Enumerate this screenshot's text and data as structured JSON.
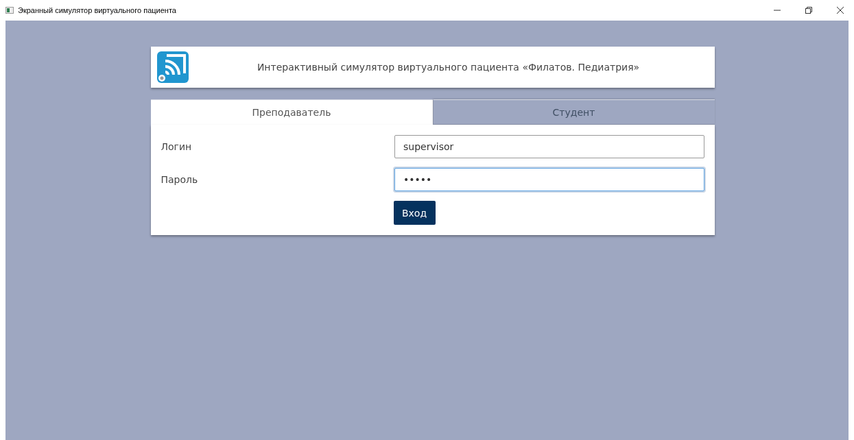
{
  "window": {
    "title": "Экранный симулятор виртуального пациента"
  },
  "header": {
    "title": "Интерактивный симулятор виртуального пациента «Филатов. Педиатрия»"
  },
  "tabs": [
    {
      "label": "Преподаватель",
      "selected": true
    },
    {
      "label": "Студент",
      "selected": false
    }
  ],
  "fields": [
    {
      "label": "Логин",
      "value": "supervisor",
      "focused": false
    },
    {
      "label": "Пароль",
      "value": "•••••",
      "focused": true
    }
  ],
  "submit": {
    "label": "Вход"
  }
}
